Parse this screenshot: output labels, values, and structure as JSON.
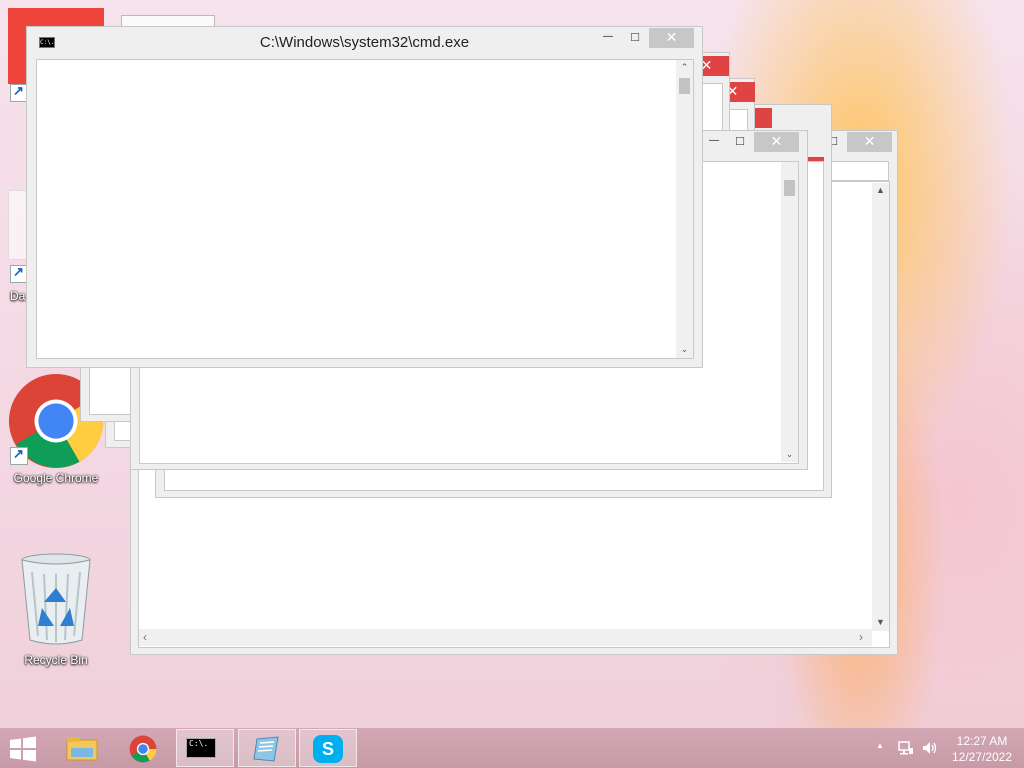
{
  "desktop": {
    "icons": [
      {
        "label": "Da"
      },
      {
        "label": "Google Chrome"
      },
      {
        "label": "Recycle Bin"
      }
    ]
  },
  "cmd_window": {
    "title": "C:\\Windows\\system32\\cmd.exe",
    "titlebar_icon_text": "C:\\."
  },
  "window_controls": {
    "minimize": "—",
    "maximize": "□",
    "close": "✕"
  },
  "taskbar": {
    "apps": [
      {
        "name": "File Explorer",
        "icon": "folder-icon"
      },
      {
        "name": "Google Chrome",
        "icon": "chrome-icon"
      },
      {
        "name": "Command Prompt",
        "icon": "cmd-icon",
        "icon_text": "C:\\."
      },
      {
        "name": "Notepad",
        "icon": "notepad-icon"
      },
      {
        "name": "Skype",
        "icon": "skype-icon",
        "icon_text": "S"
      }
    ],
    "time": "12:27 AM",
    "date": "12/27/2022",
    "tray_arrow": "▲"
  },
  "colors": {
    "close_red": "#e04343",
    "close_grey": "#c7c7c7",
    "taskbar": "#c99ca9"
  }
}
